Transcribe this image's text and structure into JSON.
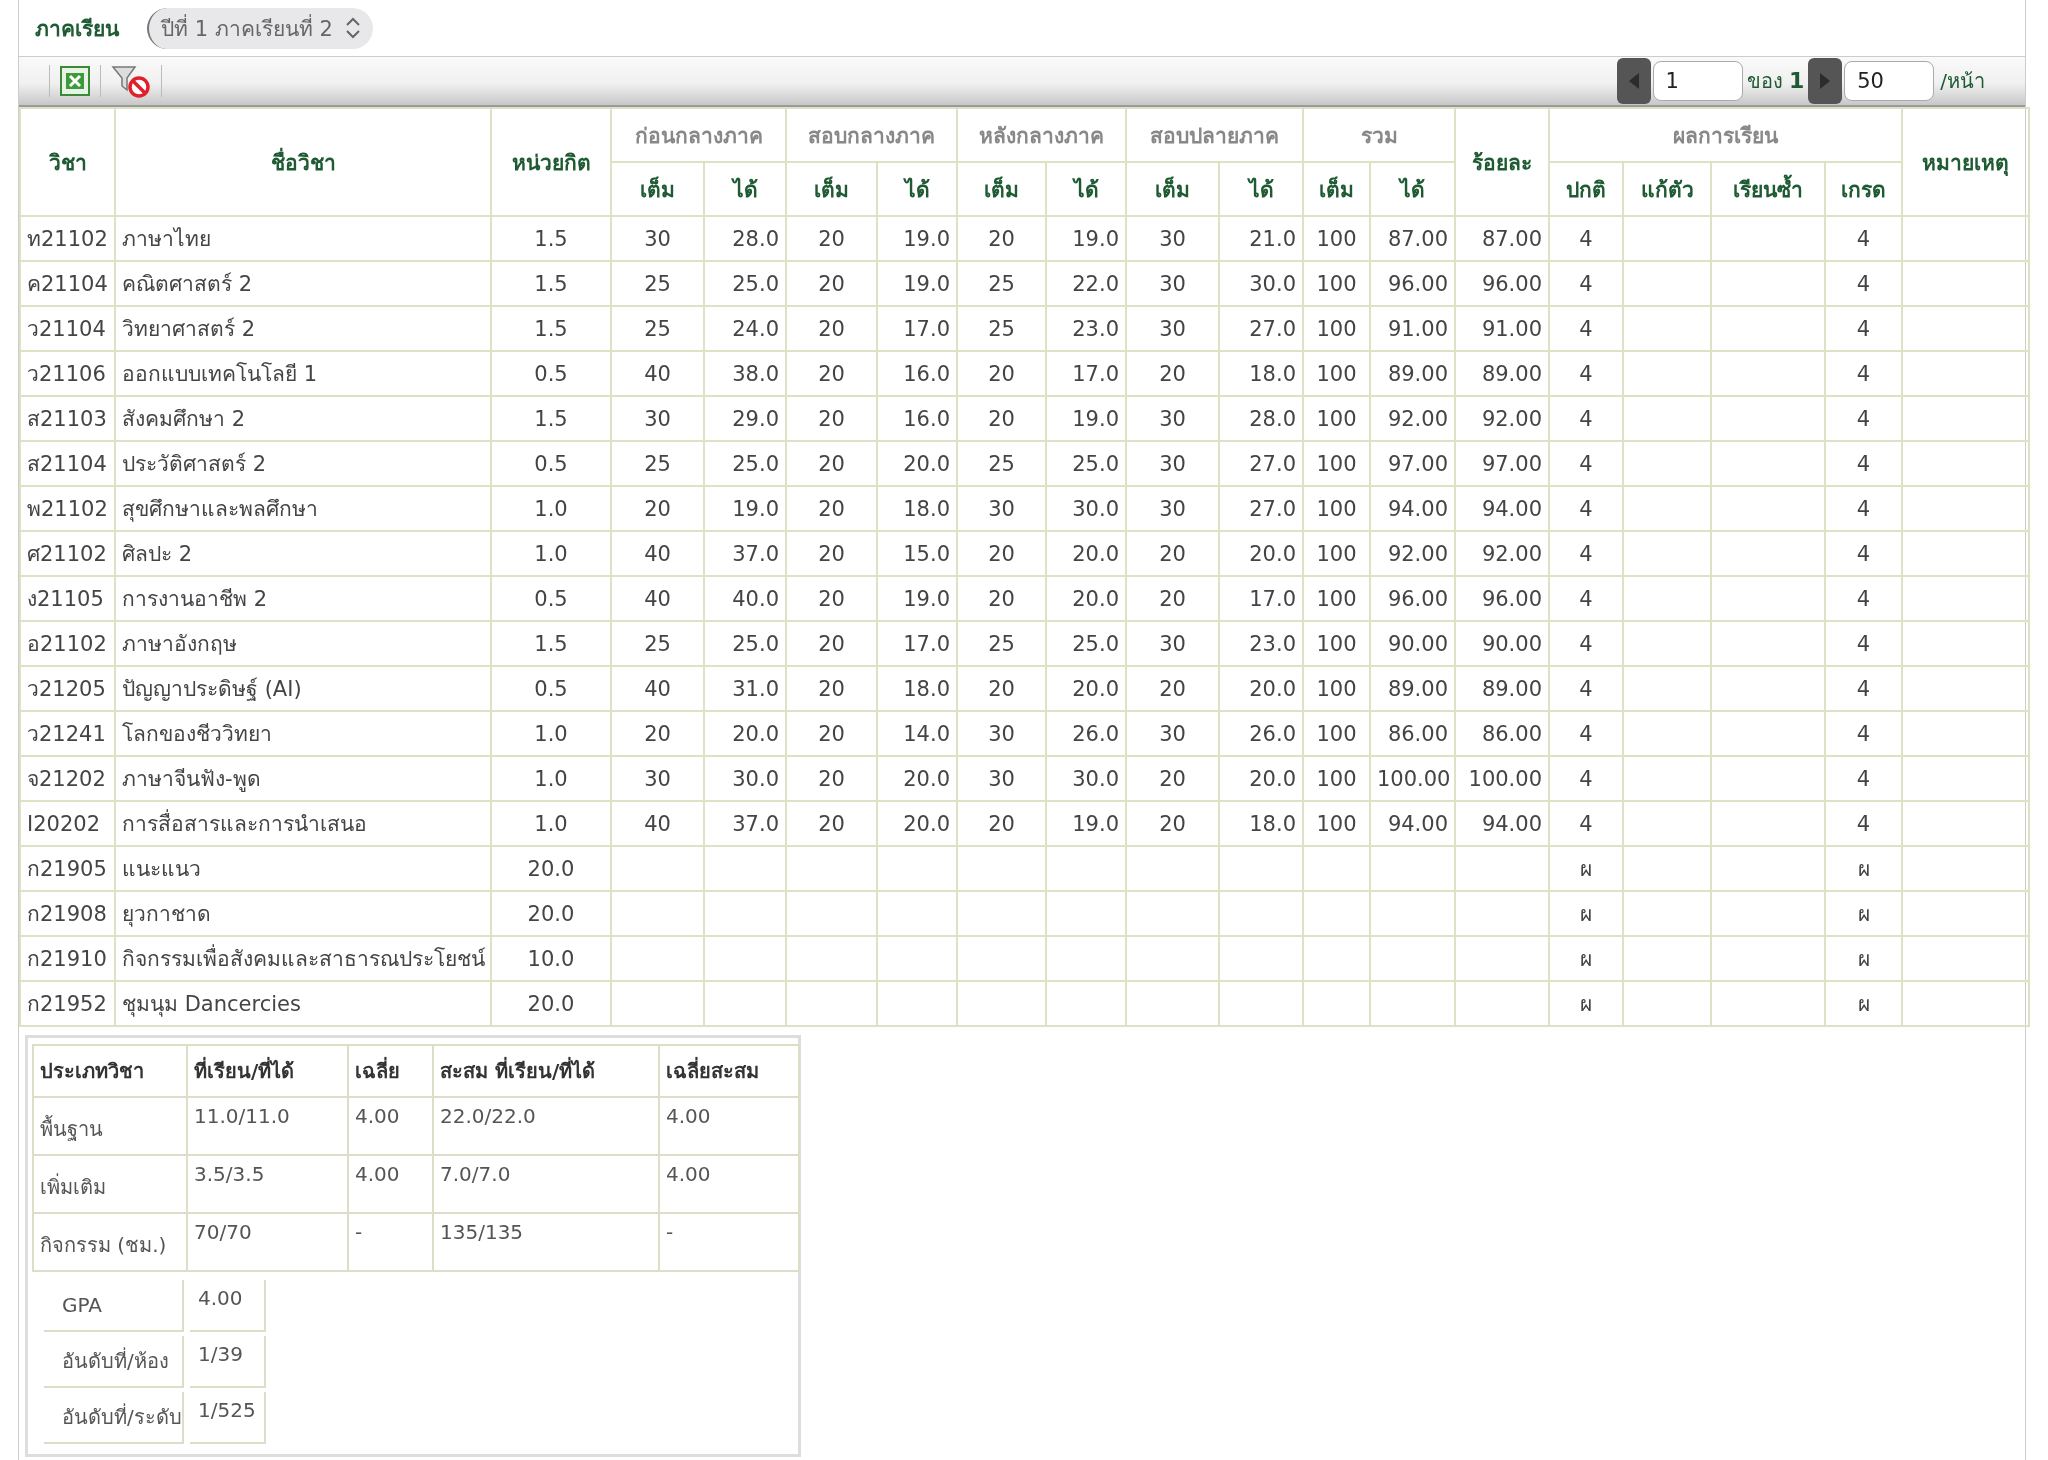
{
  "term": {
    "label": "ภาคเรียน",
    "value": "ปีที่ 1 ภาคเรียนที่ 2"
  },
  "pager": {
    "page": "1",
    "of_label": "ของ",
    "total_pages": "1",
    "per_page": "50",
    "per_page_label": "/หน้า"
  },
  "columns": [
    {
      "label": "วิชา"
    },
    {
      "label": "ชื่อวิชา"
    },
    {
      "label": "หน่วยกิต"
    },
    {
      "label": "ก่อนกลางภาค",
      "sub": [
        "เต็ม",
        "ได้"
      ]
    },
    {
      "label": "สอบกลางภาค",
      "sub": [
        "เต็ม",
        "ได้"
      ]
    },
    {
      "label": "หลังกลางภาค",
      "sub": [
        "เต็ม",
        "ได้"
      ]
    },
    {
      "label": "สอบปลายภาค",
      "sub": [
        "เต็ม",
        "ได้"
      ]
    },
    {
      "label": "รวม",
      "sub": [
        "เต็ม",
        "ได้"
      ]
    },
    {
      "label": "ร้อยละ"
    },
    {
      "label": "ผลการเรียน",
      "sub": [
        "ปกติ",
        "แก้ตัว",
        "เรียนซ้ำ",
        "เกรด"
      ]
    },
    {
      "label": "หมายเหตุ"
    }
  ],
  "rows": [
    {
      "code": "ท21102",
      "name": "ภาษาไทย",
      "credits": "1.5",
      "scores": [
        "30",
        "28.0",
        "20",
        "19.0",
        "20",
        "19.0",
        "30",
        "21.0",
        "100",
        "87.00"
      ],
      "percent": "87.00",
      "result": {
        "normal": "4",
        "grade": "4"
      }
    },
    {
      "code": "ค21104",
      "name": "คณิตศาสตร์ 2",
      "credits": "1.5",
      "scores": [
        "25",
        "25.0",
        "20",
        "19.0",
        "25",
        "22.0",
        "30",
        "30.0",
        "100",
        "96.00"
      ],
      "percent": "96.00",
      "result": {
        "normal": "4",
        "grade": "4"
      }
    },
    {
      "code": "ว21104",
      "name": "วิทยาศาสตร์ 2",
      "credits": "1.5",
      "scores": [
        "25",
        "24.0",
        "20",
        "17.0",
        "25",
        "23.0",
        "30",
        "27.0",
        "100",
        "91.00"
      ],
      "percent": "91.00",
      "result": {
        "normal": "4",
        "grade": "4"
      }
    },
    {
      "code": "ว21106",
      "name": "ออกแบบเทคโนโลยี 1",
      "credits": "0.5",
      "scores": [
        "40",
        "38.0",
        "20",
        "16.0",
        "20",
        "17.0",
        "20",
        "18.0",
        "100",
        "89.00"
      ],
      "percent": "89.00",
      "result": {
        "normal": "4",
        "grade": "4"
      }
    },
    {
      "code": "ส21103",
      "name": "สังคมศึกษา 2",
      "credits": "1.5",
      "scores": [
        "30",
        "29.0",
        "20",
        "16.0",
        "20",
        "19.0",
        "30",
        "28.0",
        "100",
        "92.00"
      ],
      "percent": "92.00",
      "result": {
        "normal": "4",
        "grade": "4"
      }
    },
    {
      "code": "ส21104",
      "name": "ประวัติศาสตร์ 2",
      "credits": "0.5",
      "scores": [
        "25",
        "25.0",
        "20",
        "20.0",
        "25",
        "25.0",
        "30",
        "27.0",
        "100",
        "97.00"
      ],
      "percent": "97.00",
      "result": {
        "normal": "4",
        "grade": "4"
      }
    },
    {
      "code": "พ21102",
      "name": "สุขศึกษาและพลศึกษา",
      "credits": "1.0",
      "scores": [
        "20",
        "19.0",
        "20",
        "18.0",
        "30",
        "30.0",
        "30",
        "27.0",
        "100",
        "94.00"
      ],
      "percent": "94.00",
      "result": {
        "normal": "4",
        "grade": "4"
      }
    },
    {
      "code": "ศ21102",
      "name": "ศิลปะ 2",
      "credits": "1.0",
      "scores": [
        "40",
        "37.0",
        "20",
        "15.0",
        "20",
        "20.0",
        "20",
        "20.0",
        "100",
        "92.00"
      ],
      "percent": "92.00",
      "result": {
        "normal": "4",
        "grade": "4"
      }
    },
    {
      "code": "ง21105",
      "name": "การงานอาชีพ 2",
      "credits": "0.5",
      "scores": [
        "40",
        "40.0",
        "20",
        "19.0",
        "20",
        "20.0",
        "20",
        "17.0",
        "100",
        "96.00"
      ],
      "percent": "96.00",
      "result": {
        "normal": "4",
        "grade": "4"
      }
    },
    {
      "code": "อ21102",
      "name": "ภาษาอังกฤษ",
      "credits": "1.5",
      "scores": [
        "25",
        "25.0",
        "20",
        "17.0",
        "25",
        "25.0",
        "30",
        "23.0",
        "100",
        "90.00"
      ],
      "percent": "90.00",
      "result": {
        "normal": "4",
        "grade": "4"
      }
    },
    {
      "code": "ว21205",
      "name": "ปัญญาประดิษฐ์ (AI)",
      "credits": "0.5",
      "scores": [
        "40",
        "31.0",
        "20",
        "18.0",
        "20",
        "20.0",
        "20",
        "20.0",
        "100",
        "89.00"
      ],
      "percent": "89.00",
      "result": {
        "normal": "4",
        "grade": "4"
      }
    },
    {
      "code": "ว21241",
      "name": "โลกของชีววิทยา",
      "credits": "1.0",
      "scores": [
        "20",
        "20.0",
        "20",
        "14.0",
        "30",
        "26.0",
        "30",
        "26.0",
        "100",
        "86.00"
      ],
      "percent": "86.00",
      "result": {
        "normal": "4",
        "grade": "4"
      }
    },
    {
      "code": "จ21202",
      "name": "ภาษาจีนฟัง-พูด",
      "credits": "1.0",
      "scores": [
        "30",
        "30.0",
        "20",
        "20.0",
        "30",
        "30.0",
        "20",
        "20.0",
        "100",
        "100.00"
      ],
      "percent": "100.00",
      "result": {
        "normal": "4",
        "grade": "4"
      }
    },
    {
      "code": "I20202",
      "name": "การสื่อสารและการนำเสนอ",
      "credits": "1.0",
      "scores": [
        "40",
        "37.0",
        "20",
        "20.0",
        "20",
        "19.0",
        "20",
        "18.0",
        "100",
        "94.00"
      ],
      "percent": "94.00",
      "result": {
        "normal": "4",
        "grade": "4"
      }
    },
    {
      "code": "ก21905",
      "name": "แนะแนว",
      "credits": "20.0",
      "result": {
        "normal": "ผ",
        "grade": "ผ"
      }
    },
    {
      "code": "ก21908",
      "name": "ยุวกาชาด",
      "credits": "20.0",
      "result": {
        "normal": "ผ",
        "grade": "ผ"
      }
    },
    {
      "code": "ก21910",
      "name": "กิจกรรมเพื่อสังคมและสาธารณประโยชน์",
      "credits": "10.0",
      "result": {
        "normal": "ผ",
        "grade": "ผ"
      }
    },
    {
      "code": "ก21952",
      "name": "ชุมนุม Dancercies",
      "credits": "20.0",
      "result": {
        "normal": "ผ",
        "grade": "ผ"
      }
    }
  ],
  "summary": {
    "columns": [
      "ประเภทวิชา",
      "ที่เรียน/ที่ได้",
      "เฉลี่ย",
      "สะสม ที่เรียน/ที่ได้",
      "เฉลี่ยสะสม"
    ],
    "rows": [
      [
        "พื้นฐาน",
        "11.0/11.0",
        "4.00",
        "22.0/22.0",
        "4.00"
      ],
      [
        "เพิ่มเติม",
        "3.5/3.5",
        "4.00",
        "7.0/7.0",
        "4.00"
      ],
      [
        "กิจกรรม (ชม.)",
        "70/70",
        "-",
        "135/135",
        "-"
      ]
    ],
    "stats": [
      {
        "label": "GPA",
        "value": "4.00"
      },
      {
        "label": "อันดับที่/ห้อง",
        "value": "1/39"
      },
      {
        "label": "อันดับที่/ระดับ",
        "value": "1/525"
      }
    ]
  }
}
